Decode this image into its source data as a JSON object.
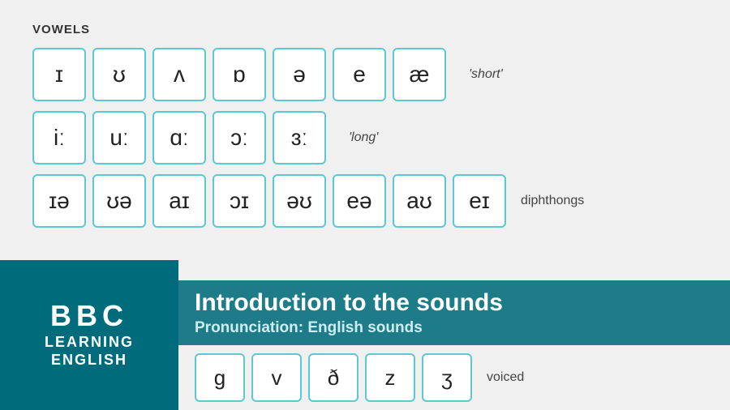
{
  "section": {
    "vowels_label": "VOWELS"
  },
  "rows": {
    "short": {
      "label": "'short'",
      "symbols": [
        "ɪ",
        "ʊ",
        "ʌ",
        "ɒ",
        "ə",
        "e",
        "æ"
      ]
    },
    "long": {
      "label": "'long'",
      "symbols": [
        "iː",
        "uː",
        "ɑː",
        "ɔː",
        "ɜː"
      ]
    },
    "diphthongs": {
      "label": "diphthongs",
      "symbols": [
        "ɪə",
        "ʊə",
        "aɪ",
        "ɔɪ",
        "əʊ",
        "eə",
        "aʊ",
        "eɪ"
      ]
    }
  },
  "bottom_row": {
    "symbols": [
      "g",
      "v",
      "ð",
      "z",
      "ʒ"
    ],
    "label": "voiced"
  },
  "bbc": {
    "bbc_text": "BBC",
    "learning": "LEARNING",
    "english": "ENGLISH"
  },
  "title": {
    "main": "Introduction to the sounds",
    "sub": "Pronunciation: English sounds"
  }
}
